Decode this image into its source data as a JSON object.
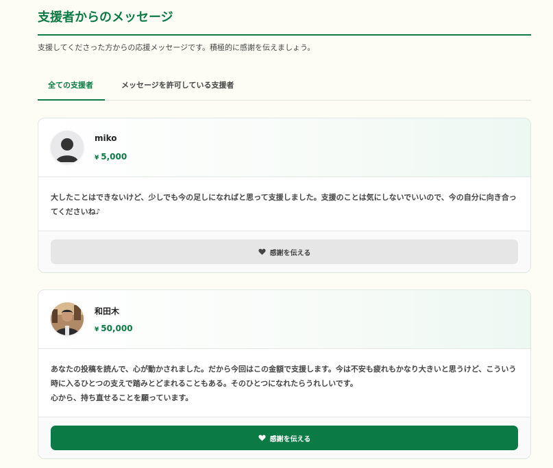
{
  "header": {
    "title": "支援者からのメッセージ",
    "description": "支援してくださった方からの応援メッセージです。積極的に感謝を伝えましょう。"
  },
  "tabs": [
    {
      "label": "全ての支援者",
      "active": true
    },
    {
      "label": "メッセージを許可している支援者",
      "active": false
    }
  ],
  "currency_symbol": "¥",
  "supporters": [
    {
      "name": "miko",
      "amount": "5,000",
      "message": [
        "大したことはできないけど、少しでも今の足しになればと思って支援しました。支援のことは気にしないでいいので、今の自分に向き合ってくださいね♪"
      ],
      "button_label": "感謝を伝える",
      "button_style": "gray",
      "avatar": "default-user-icon"
    },
    {
      "name": "和田木",
      "amount": "50,000",
      "message": [
        "あなたの投稿を読んで、心が動かされました。だから今回はこの金額で支援します。今は不安も疲れもかなり大きいと思うけど、こういう時に入るひとつの支えで踏みとどまれることもある。そのひとつになれたらうれしいです。",
        "心から、持ち直せることを願っています。"
      ],
      "button_label": "感謝を伝える",
      "button_style": "green",
      "avatar": "user-photo"
    }
  ],
  "colors": {
    "accent": "#0b7a45",
    "button_gray": "#e6e6e6",
    "background": "#fdfdf5"
  }
}
